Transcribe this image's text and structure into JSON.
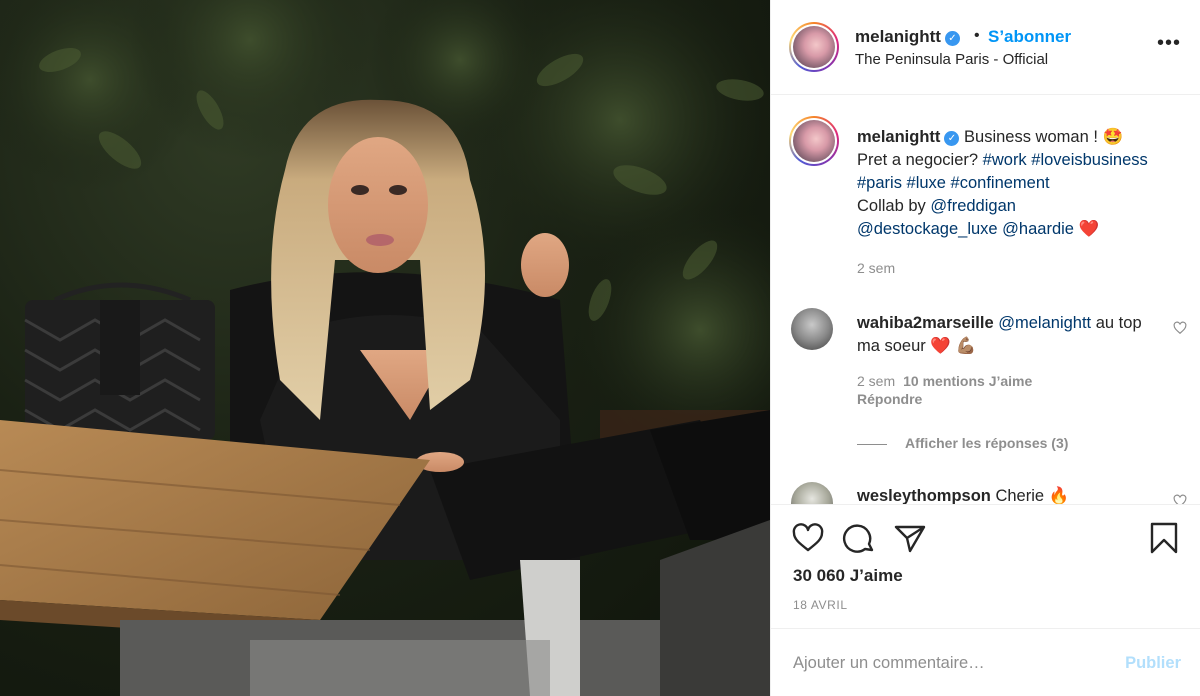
{
  "header": {
    "username": "melanightt",
    "verified_glyph": "✓",
    "separator": "•",
    "follow_label": "S’abonner",
    "location": "The Peninsula Paris - Official",
    "more_glyph": "•••"
  },
  "caption": {
    "username": "melanightt",
    "text_before": "Business woman ! 🤩",
    "line2": "Pret a negocier? ",
    "tags1": "#work #loveisbusiness",
    "tags2": "#paris #luxe #confinement",
    "collab": "Collab by ",
    "mention1": "@freddigan",
    "mention2": "@destockage_luxe @haardie",
    "heart": " ❤️",
    "time": "2 sem"
  },
  "comments": [
    {
      "username": "wahiba2marseille",
      "mention": "@melanightt",
      "text": " au top ma soeur ❤️ 💪🏽",
      "time": "2 sem",
      "likes": "10 mentions J’aime",
      "reply": "Répondre",
      "view_replies": "Afficher les réponses (3)"
    },
    {
      "username": "wesleythompson",
      "text": " Cherie 🔥"
    }
  ],
  "actions": {
    "likes": "30 060 J’aime",
    "date": "18 AVRIL",
    "icons": [
      "heart-icon",
      "comment-icon",
      "share-icon",
      "bookmark-icon"
    ]
  },
  "add_comment": {
    "placeholder": "Ajouter un commentaire…",
    "publish": "Publier"
  },
  "colors": {
    "link_blue": "#0095f6",
    "hashtag_blue": "#00376b",
    "verified_blue": "#3897f0",
    "muted": "#8e8e8e",
    "publish_disabled": "#b2dffc"
  }
}
